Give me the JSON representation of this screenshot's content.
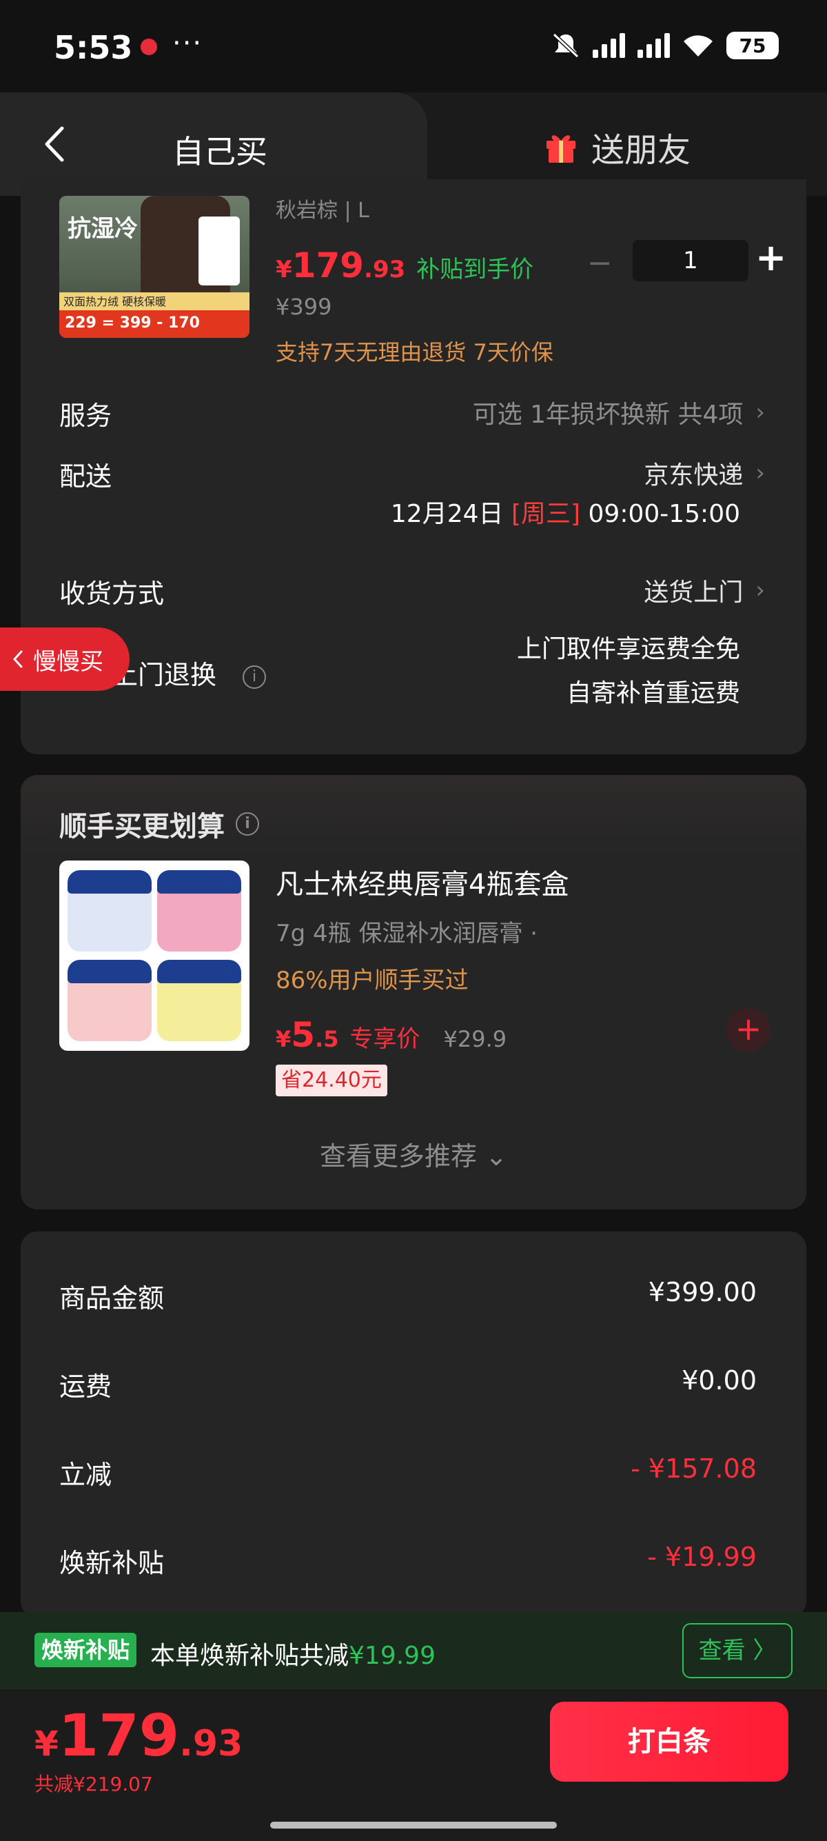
{
  "status": {
    "time": "5:53",
    "dots": "···",
    "battery": "75"
  },
  "header": {
    "tab_self": "自己买",
    "tab_gift": "送朋友"
  },
  "product": {
    "sku": "秋岩棕 | L",
    "thumb": {
      "tag": "抗湿冷",
      "strip": "双面热力绒 硬核保暖",
      "bottom": "229 = 399 - 170"
    },
    "price_yen": "¥",
    "price_int": "179",
    "price_dec": ".93",
    "subsidy_note": "补贴到手价",
    "orig_price": "¥399",
    "return_note": "支持7天无理由退货  7天价保",
    "qty_minus": "−",
    "quantity": "1",
    "qty_plus": "+"
  },
  "rows": {
    "service_label": "服务",
    "service_value": "可选 1年损坏换新 共4项",
    "delivery_label": "配送",
    "delivery_value": "京东快递",
    "delivery_date": "12月24日",
    "delivery_weekday": "[周三]",
    "delivery_window": "09:00-15:00",
    "receive_label": "收货方式",
    "receive_value": "送货上门",
    "return_label": "免费上门退换",
    "return_line1": "上门取件享运费全免",
    "return_line2": "自寄补首重运费",
    "chevron": "›",
    "info": "i"
  },
  "slow_buy": {
    "label": "慢慢买"
  },
  "recommend": {
    "title": "顺手买更划算",
    "name": "凡士林经典唇膏4瓶套盒",
    "spec": "7g 4瓶 保湿补水润唇膏 ·",
    "bought": "86%用户顺手买过",
    "price_yen": "¥",
    "price_int": "5",
    "price_dec": ".5",
    "price_tag": "专享价",
    "orig_price": "¥29.9",
    "save": "省24.40元",
    "add": "+",
    "more": "查看更多推荐 ⌄"
  },
  "summary": {
    "goods_label": "商品金额",
    "goods_value": "¥399.00",
    "shipping_label": "运费",
    "shipping_value": "¥0.00",
    "discount_label": "立减",
    "discount_value": "- ¥157.08",
    "subsidy_label": "焕新补贴",
    "subsidy_value": "- ¥19.99"
  },
  "subsidy_bar": {
    "badge": "焕新补贴",
    "text": "本单焕新补贴共减",
    "amount": "¥19.99",
    "button": "查看 〉"
  },
  "bottom": {
    "total_yen": "¥",
    "total_int": "179",
    "total_dec": ".93",
    "total_sub": "共减¥219.07",
    "pay_button": "打白条"
  },
  "colors": {
    "accent_red": "#ff2e3b",
    "subsidy_green": "#2ec25a",
    "orange": "#e0934b",
    "background": "#121212",
    "card": "#252525"
  }
}
